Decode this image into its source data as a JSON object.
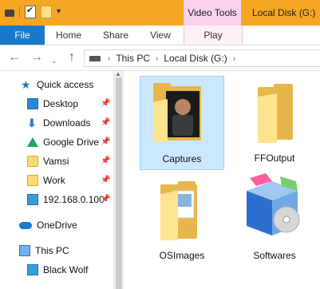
{
  "titlebar": {
    "contextual_label": "Video Tools",
    "window_title": "Local Disk (G:)"
  },
  "ribbon": {
    "tabs": [
      "File",
      "Home",
      "Share",
      "View",
      "Play"
    ]
  },
  "address": {
    "crumbs": [
      "This PC",
      "Local Disk (G:)"
    ]
  },
  "nav": {
    "items": [
      {
        "label": "Quick access",
        "icon": "star-icon"
      },
      {
        "label": "Desktop",
        "icon": "desktop-icon"
      },
      {
        "label": "Downloads",
        "icon": "download-arrow-icon"
      },
      {
        "label": "Google Drive",
        "icon": "google-drive-icon"
      },
      {
        "label": "Vamsi",
        "icon": "folder-icon"
      },
      {
        "label": "Work",
        "icon": "folder-icon"
      },
      {
        "label": "192.168.0.100",
        "icon": "network-drive-icon"
      },
      {
        "label": "OneDrive",
        "icon": "onedrive-cloud-icon"
      },
      {
        "label": "This PC",
        "icon": "computer-icon"
      },
      {
        "label": "Black Wolf",
        "icon": "network-drive-icon"
      }
    ]
  },
  "files": [
    {
      "name": "Captures",
      "selected": true
    },
    {
      "name": "FFOutput",
      "selected": false
    },
    {
      "name": "OSImages",
      "selected": false
    },
    {
      "name": "Softwares",
      "selected": false
    }
  ],
  "colors": {
    "titlebar": "#f5a623",
    "contextual": "#f9d1ea",
    "file_tab": "#1979ca",
    "selection": "#cce8ff"
  }
}
